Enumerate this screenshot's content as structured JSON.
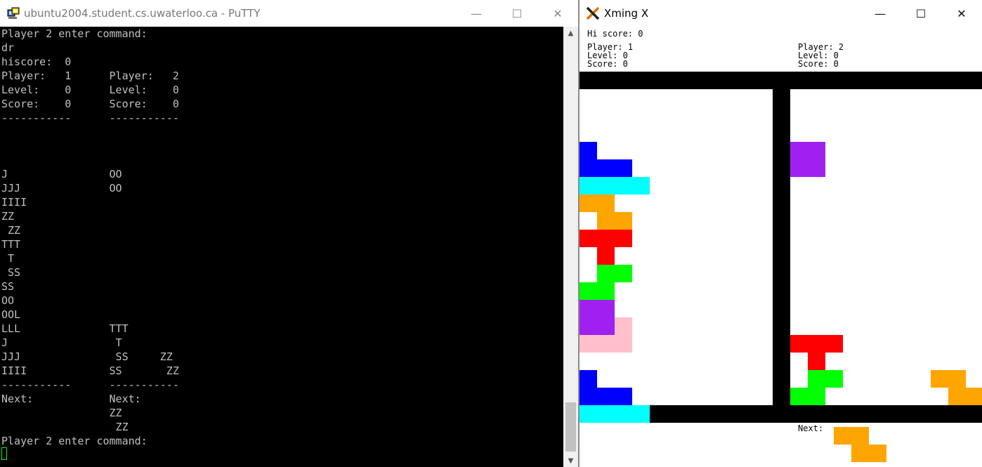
{
  "putty": {
    "title": "ubuntu2004.student.cs.uwaterloo.ca - PuTTY",
    "icon": "putty-icon",
    "controls": {
      "minimize": "—",
      "maximize": "☐",
      "close": "✕"
    },
    "terminal_lines": [
      "Player 2 enter command:",
      "dr",
      "hiscore:  0",
      "Player:   1      Player:   2",
      "Level:    0      Level:    0",
      "Score:    0      Score:    0",
      "-----------      -----------",
      "",
      "",
      "",
      "J                OO",
      "JJJ              OO",
      "IIII",
      "ZZ",
      " ZZ",
      "TTT",
      " T",
      " SS",
      "SS",
      "OO",
      "OOL",
      "LLL              TTT",
      "J                 T",
      "JJJ               SS     ZZ",
      "IIII             SS       ZZ",
      "-----------      -----------",
      "Next:            Next:",
      "                 ZZ",
      "                  ZZ",
      "Player 2 enter command:"
    ],
    "cursor_color": "#00ff00"
  },
  "xming": {
    "title": "Xming X",
    "icon": "xming-x-icon",
    "controls": {
      "minimize": "—",
      "maximize": "☐",
      "close": "✕"
    },
    "hi_score": "Hi score: 0",
    "player1": {
      "player": "Player: 1",
      "level": "Level: 0",
      "score": "Score: 0"
    },
    "player2": {
      "player": "Player: 2",
      "level": "Level: 0",
      "score": "Score: 0"
    },
    "next_label": "Next:",
    "colors": {
      "J": "#0000ff",
      "I": "#00ffff",
      "Z": "#ffa500",
      "T": "#ff0000",
      "S": "#00ff00",
      "O": "#a020f0",
      "L": "#ffc0cb",
      "wall": "#000000"
    },
    "board1_rows": [
      "",
      "",
      "",
      "",
      "J",
      "JJJ",
      "IIII",
      "ZZ",
      " ZZ",
      "TTT",
      " T",
      " SS",
      "SS",
      "OO",
      "OOL",
      "LLL",
      "",
      "J",
      "JJJ",
      "IIII"
    ],
    "board2_rows": [
      "",
      "",
      "",
      "",
      "OO",
      "OO",
      "",
      "",
      "",
      "",
      "",
      "",
      "",
      "",
      "",
      "TTT",
      " T",
      " SS     ZZ",
      "SS       ZZ",
      ""
    ],
    "next2_rows": [
      "ZZ",
      " ZZ"
    ]
  }
}
